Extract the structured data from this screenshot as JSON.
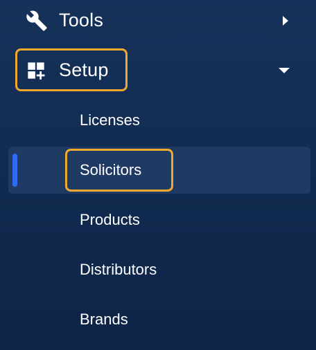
{
  "nav": {
    "tools": {
      "label": "Tools",
      "icon": "wrench-icon"
    },
    "setup": {
      "label": "Setup",
      "icon": "grid-plus-icon"
    },
    "setup_children": [
      {
        "label": "Licenses"
      },
      {
        "label": "Solicitors",
        "active": true
      },
      {
        "label": "Products"
      },
      {
        "label": "Distributors"
      },
      {
        "label": "Brands"
      }
    ]
  },
  "colors": {
    "background": "#112a4f",
    "active_background": "#1f3b64",
    "active_indicator": "#2f6cf6",
    "highlight_outline": "#f0a92e",
    "text": "#ffffff"
  }
}
